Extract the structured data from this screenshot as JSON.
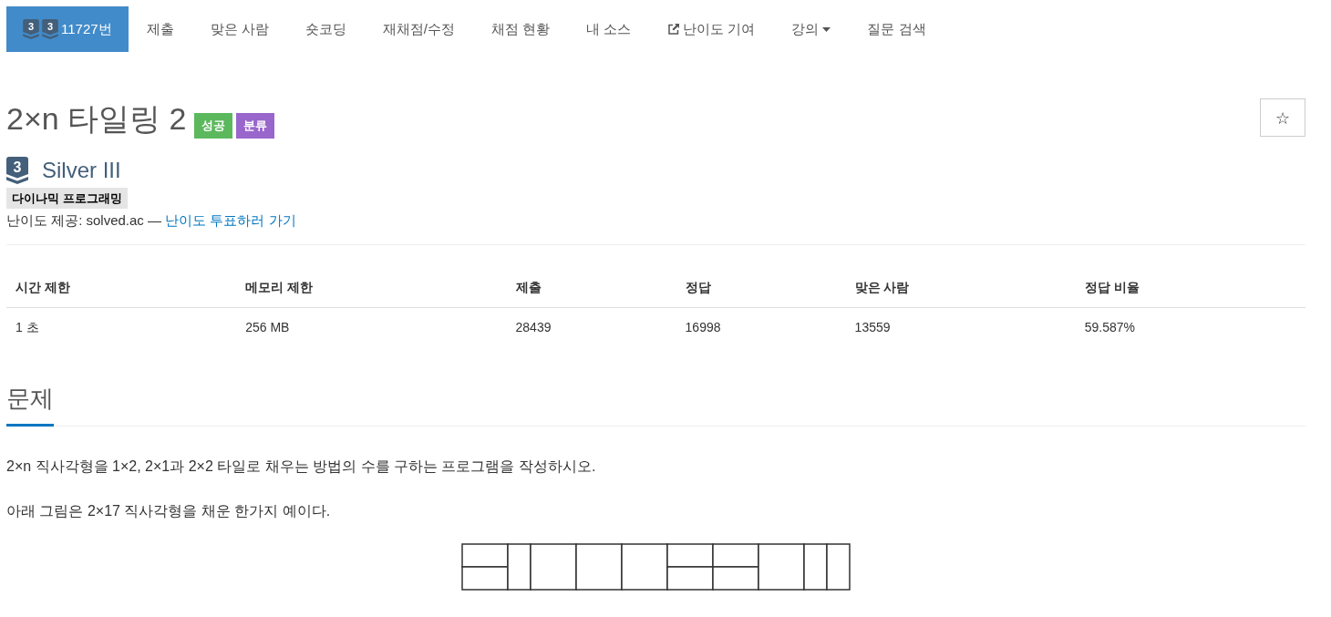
{
  "nav": {
    "items": [
      {
        "kind": "problem",
        "badges": [
          "3",
          "3"
        ],
        "label": "11727번",
        "selected": true
      },
      {
        "kind": "link",
        "label": "제출",
        "selected": false
      },
      {
        "kind": "link",
        "label": "맞은 사람",
        "selected": false
      },
      {
        "kind": "link",
        "label": "숏코딩",
        "selected": false
      },
      {
        "kind": "link",
        "label": "재채점/수정",
        "selected": false
      },
      {
        "kind": "link",
        "label": "채점 현황",
        "selected": false
      },
      {
        "kind": "link",
        "label": "내 소스",
        "selected": false
      },
      {
        "kind": "external",
        "label": "난이도 기여",
        "selected": false
      },
      {
        "kind": "dropdown",
        "label": "강의",
        "selected": false
      },
      {
        "kind": "link",
        "label": "질문 검색",
        "selected": false
      }
    ]
  },
  "problem": {
    "title": "2×n 타일링 2",
    "labels": [
      {
        "text": "성공",
        "color": "#5cb85c"
      },
      {
        "text": "분류",
        "color": "#9966cc"
      }
    ],
    "star_button": "☆",
    "tier": {
      "badge": "3",
      "name": "Silver III"
    },
    "tags": [
      "다이나믹 프로그래밍"
    ],
    "difficulty_source": {
      "text": "난이도 제공: solved.ac —",
      "link": "난이도 투표하러 가기"
    }
  },
  "info_table": {
    "columns": [
      "시간 제한",
      "메모리 제한",
      "제출",
      "정답",
      "맞은 사람",
      "정답 비율"
    ],
    "rows": [
      [
        "1 초",
        "256 MB",
        "28439",
        "16998",
        "13559",
        "59.587%"
      ]
    ]
  },
  "description": {
    "heading": "문제",
    "paragraphs": [
      "2×n 직사각형을 1×2, 2×1과 2×2 타일로 채우는 방법의 수를 구하는 프로그램을 작성하시오.",
      "아래 그림은 2×17 직사각형을 채운 한가지 예이다."
    ],
    "figure": {
      "tiles": [
        {
          "kind": "stacked"
        },
        {
          "kind": "vertical"
        },
        {
          "kind": "square"
        },
        {
          "kind": "square"
        },
        {
          "kind": "square"
        },
        {
          "kind": "stacked"
        },
        {
          "kind": "stacked"
        },
        {
          "kind": "square"
        },
        {
          "kind": "vertical"
        },
        {
          "kind": "vertical"
        }
      ]
    }
  }
}
